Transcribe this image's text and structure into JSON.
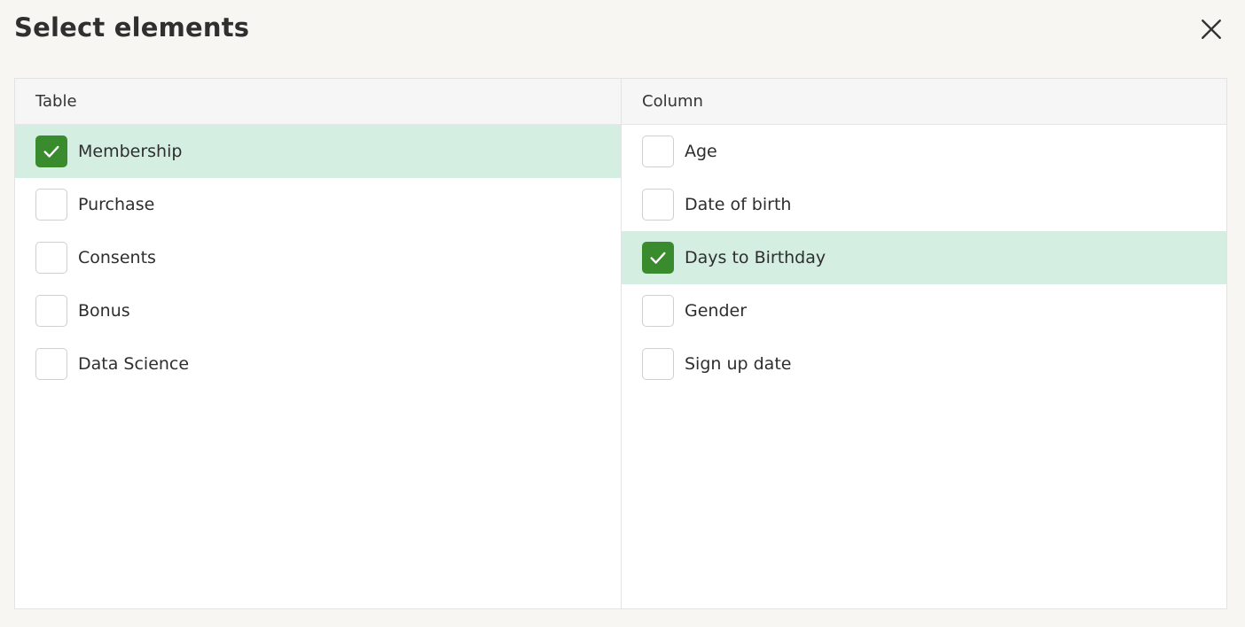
{
  "dialog": {
    "title": "Select elements",
    "close_icon": "close-icon"
  },
  "colors": {
    "selected_row": "#d4efe1",
    "checkbox_checked": "#3a8a2e",
    "background": "#f7f6f2"
  },
  "table_pane": {
    "header": "Table",
    "items": [
      {
        "label": "Membership",
        "checked": true
      },
      {
        "label": "Purchase",
        "checked": false
      },
      {
        "label": "Consents",
        "checked": false
      },
      {
        "label": "Bonus",
        "checked": false
      },
      {
        "label": "Data Science",
        "checked": false
      }
    ]
  },
  "column_pane": {
    "header": "Column",
    "items": [
      {
        "label": "Age",
        "checked": false
      },
      {
        "label": "Date of birth",
        "checked": false
      },
      {
        "label": "Days to Birthday",
        "checked": true
      },
      {
        "label": "Gender",
        "checked": false
      },
      {
        "label": "Sign up date",
        "checked": false
      }
    ]
  }
}
